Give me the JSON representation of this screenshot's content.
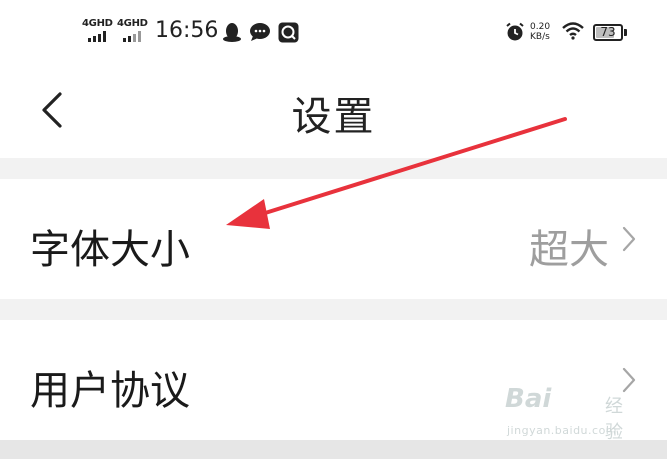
{
  "status_bar": {
    "signal_1": "4GHD",
    "signal_2": "4GHD",
    "time": "16:56",
    "net_speed_value": "0.20",
    "net_speed_unit": "KB/s",
    "battery_level": "73",
    "battery_fraction": 0.73,
    "icons": [
      "qq-penguin-icon",
      "chat-bubble-icon",
      "search-app-icon",
      "alarm-icon",
      "wifi-icon",
      "battery-icon"
    ]
  },
  "nav": {
    "title": "设置",
    "back_icon": "chevron-left-icon"
  },
  "settings": {
    "font_size": {
      "label": "字体大小",
      "value": "超大"
    },
    "user_agreement": {
      "label": "用户协议"
    }
  },
  "watermark": {
    "brand": "Bai",
    "sub": "经验",
    "url": "jingyan.baidu.com"
  },
  "colors": {
    "annotation_arrow": "#e8323c",
    "background": "#f2f2f2",
    "row_background": "#ffffff",
    "value_text": "#9e9e9e"
  }
}
